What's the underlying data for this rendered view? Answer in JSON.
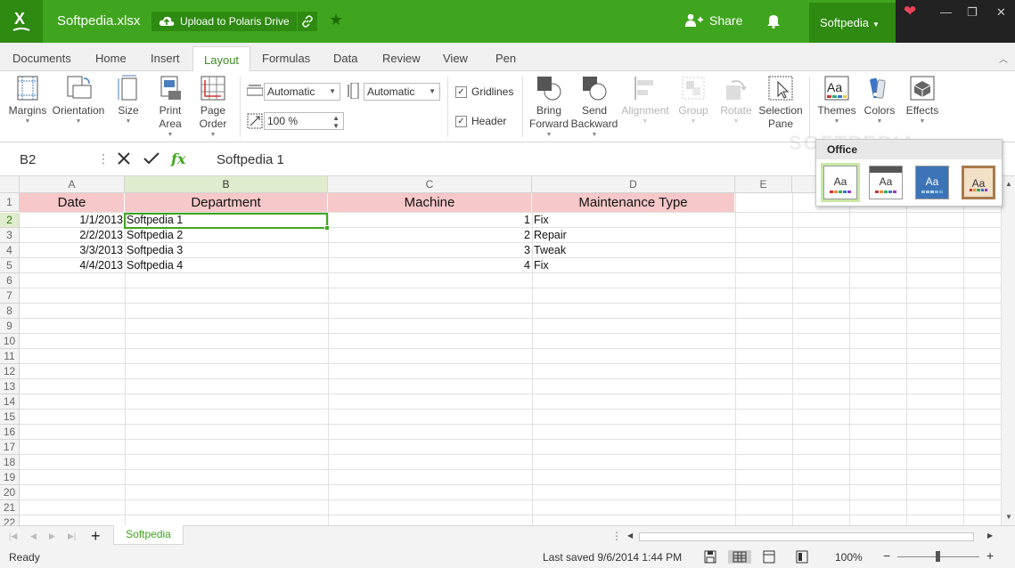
{
  "titlebar": {
    "filename": "Softpedia.xlsx",
    "upload_label": "Upload to Polaris Drive",
    "share_label": "Share",
    "user_label": "Softpedia"
  },
  "tabs": [
    "Documents",
    "Home",
    "Insert",
    "Layout",
    "Formulas",
    "Data",
    "Review",
    "View",
    "Pen"
  ],
  "active_tab": "Layout",
  "ribbon": {
    "margins": "Margins",
    "orientation": "Orientation",
    "size": "Size",
    "print": "Print",
    "area": "Area",
    "page": "Page",
    "order": "Order",
    "width_value": "Automatic",
    "height_value": "Automatic",
    "scale_value": "100 %",
    "gridlines": "Gridlines",
    "header": "Header",
    "bring": "Bring",
    "forward": "Forward",
    "send": "Send",
    "backward": "Backward",
    "alignment": "Alignment",
    "group": "Group",
    "rotate": "Rotate",
    "selection": "Selection",
    "pane": "Pane",
    "themes": "Themes",
    "colors": "Colors",
    "effects": "Effects"
  },
  "themes_panel": {
    "header": "Office",
    "sample": "Aa"
  },
  "formula_bar": {
    "cell_ref": "B2",
    "fx": "fx",
    "value": "Softpedia 1"
  },
  "columns": [
    "A",
    "B",
    "C",
    "D",
    "E"
  ],
  "rows": [
    "1",
    "2",
    "3",
    "4",
    "5",
    "6",
    "7",
    "8",
    "9",
    "10",
    "11",
    "12",
    "13",
    "14",
    "15",
    "16",
    "17",
    "18",
    "19",
    "20",
    "21",
    "22"
  ],
  "headers": [
    "Date",
    "Department",
    "Machine",
    "Maintenance Type"
  ],
  "data_rows": [
    [
      "1/1/2013",
      "Softpedia 1",
      "1",
      "Fix"
    ],
    [
      "2/2/2013",
      "Softpedia 2",
      "2",
      "Repair"
    ],
    [
      "3/3/2013",
      "Softpedia 3",
      "3",
      "Tweak"
    ],
    [
      "4/4/2013",
      "Softpedia 4",
      "4",
      "Fix"
    ]
  ],
  "sheet_tab": "Softpedia",
  "status": {
    "ready": "Ready",
    "saved": "Last saved 9/6/2014 1:44 PM",
    "zoom": "100%"
  },
  "colors": {
    "brand": "#3fa51e",
    "header_fill": "#f7c8c9"
  }
}
